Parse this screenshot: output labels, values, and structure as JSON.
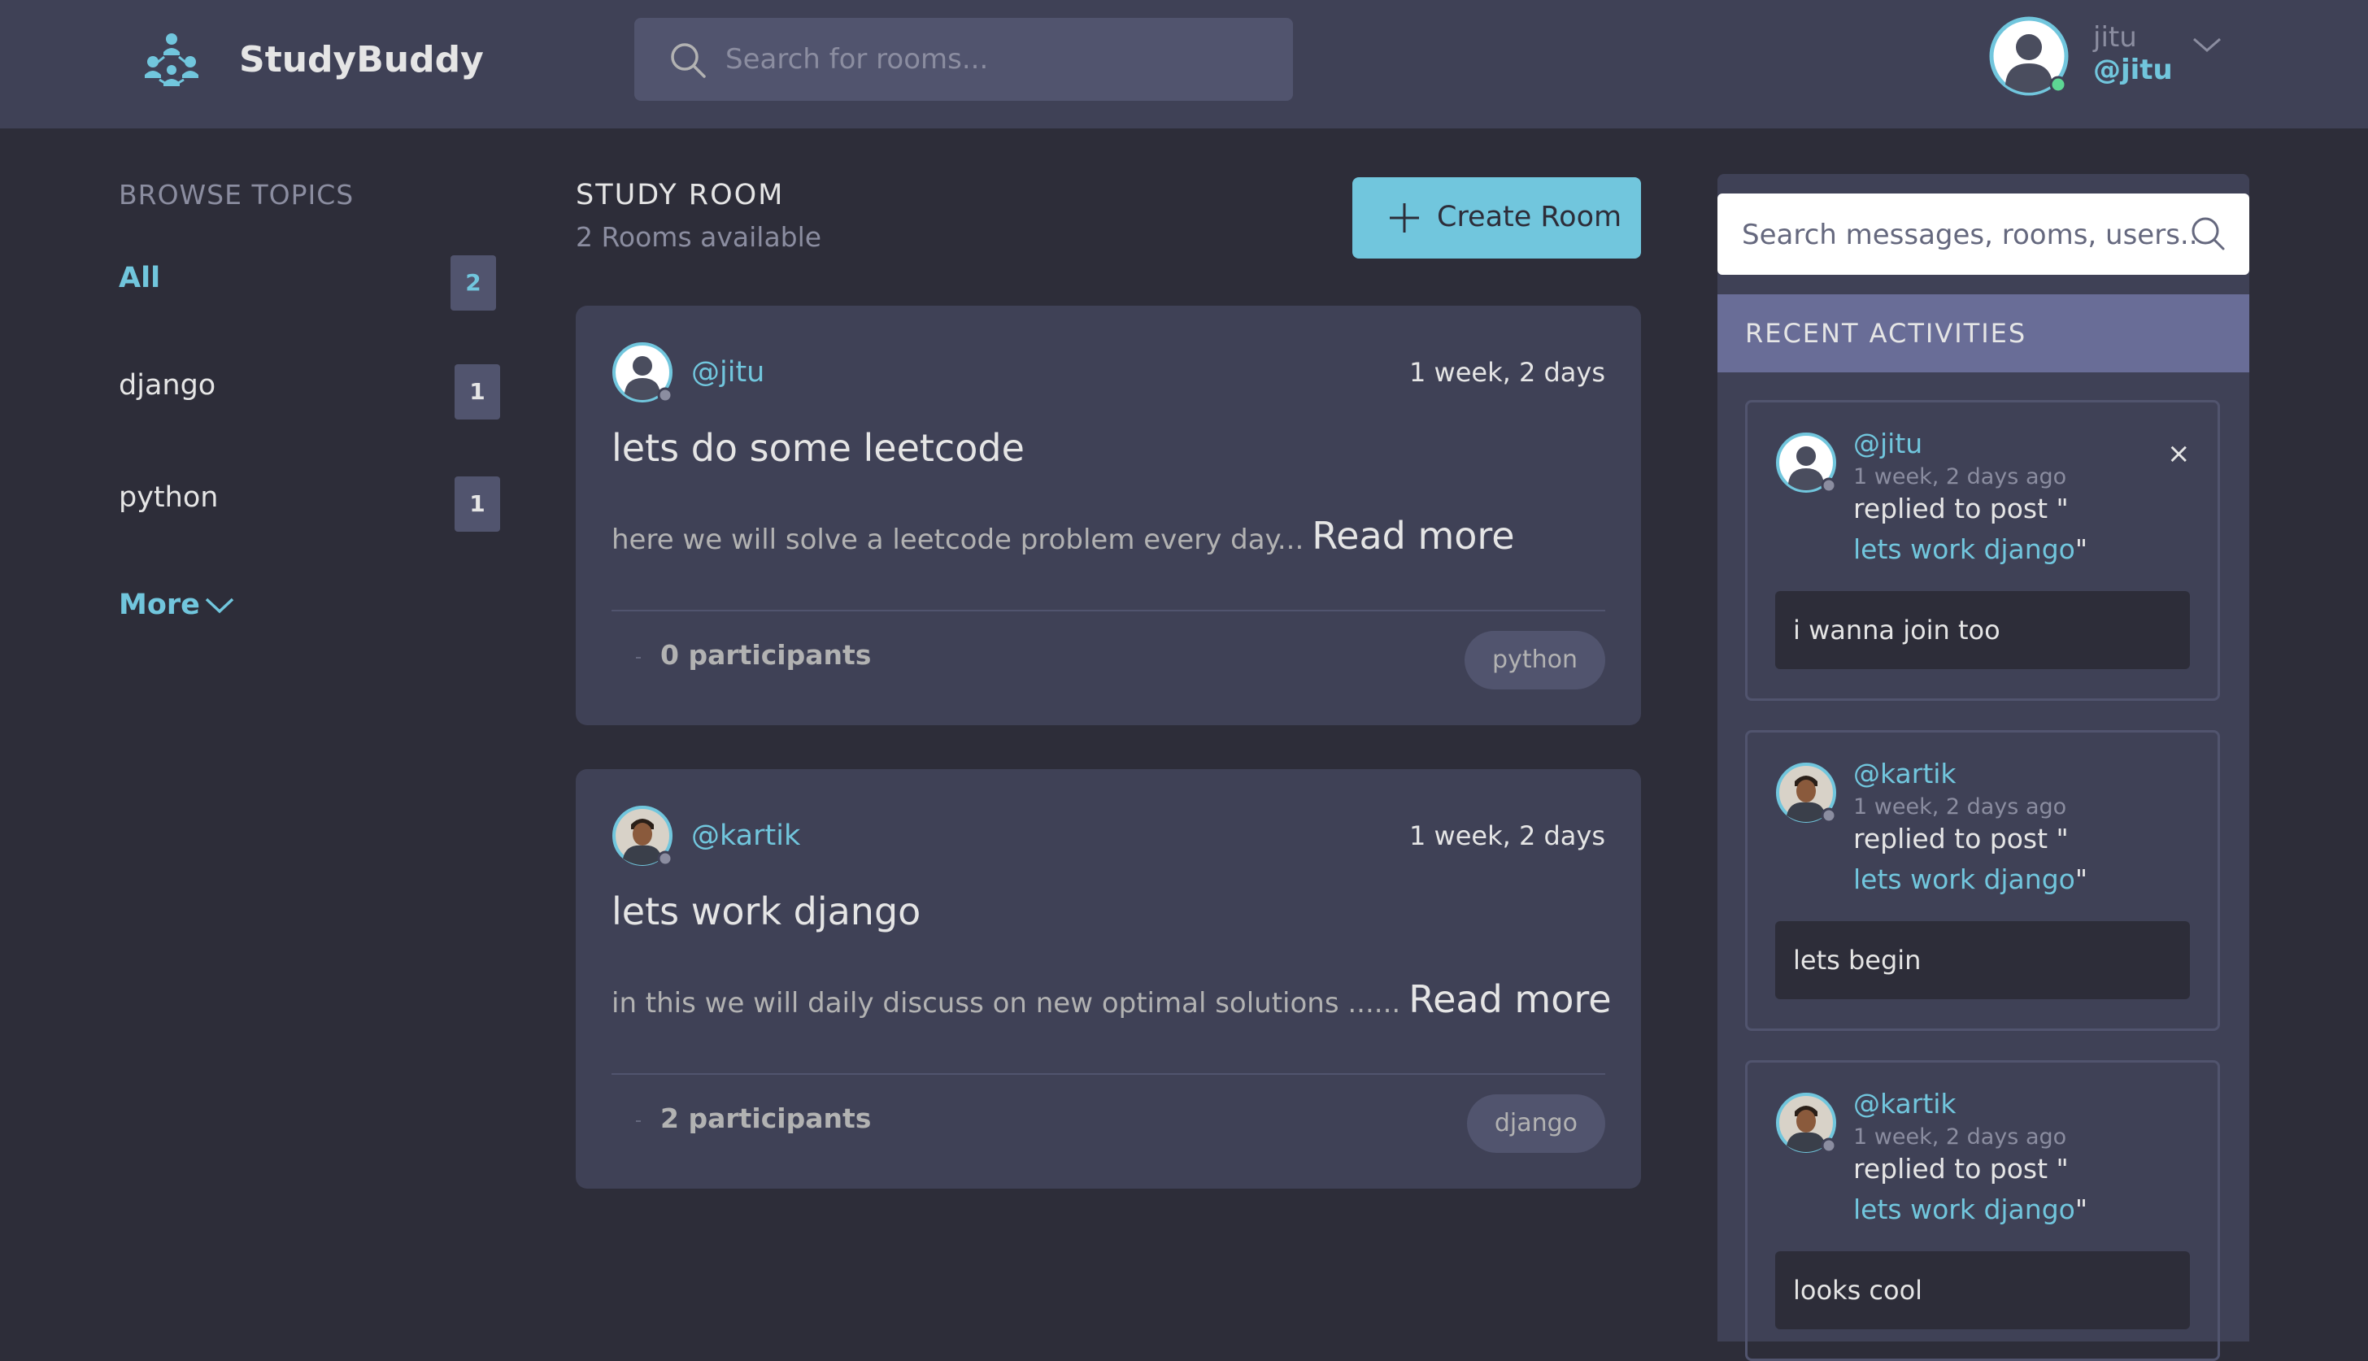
{
  "header": {
    "app_name": "StudyBuddy",
    "search_placeholder": "Search for rooms...",
    "user_name": "jitu",
    "user_handle": "@jitu"
  },
  "sidebar": {
    "title": "BROWSE TOPICS",
    "topics": [
      {
        "label": "All",
        "count": "2"
      },
      {
        "label": "django",
        "count": "1"
      },
      {
        "label": "python",
        "count": "1"
      }
    ],
    "more_label": "More"
  },
  "main": {
    "title": "STUDY ROOM",
    "subtitle": "2 Rooms available",
    "create_label": "Create Room",
    "rooms": [
      {
        "host": "@jitu",
        "time": "1 week, 2 days",
        "title": "lets do some leetcode",
        "description": "here we will solve a leetcode problem every day...",
        "read_more": "Read more",
        "participants": "0 participants",
        "topic": "python"
      },
      {
        "host": "@kartik",
        "time": "1 week, 2 days",
        "title": "lets work django",
        "description": "in this we will daily discuss on new optimal solutions ......",
        "read_more": "Read more",
        "participants": "2 participants",
        "topic": "django"
      }
    ]
  },
  "activity": {
    "search_placeholder": "Search messages, rooms, users...",
    "title": "RECENT ACTIVITIES",
    "items": [
      {
        "handle": "@jitu",
        "time": "1 week, 2 days ago",
        "replied": "replied to post \"",
        "post": "lets work django",
        "post_suffix": "\"",
        "message": "i wanna join too",
        "close": "×"
      },
      {
        "handle": "@kartik",
        "time": "1 week, 2 days ago",
        "replied": "replied to post \"",
        "post": "lets work django",
        "post_suffix": "\"",
        "message": "lets begin"
      },
      {
        "handle": "@kartik",
        "time": "1 week, 2 days ago",
        "replied": "replied to post \"",
        "post": "lets work django",
        "post_suffix": "\"",
        "message": "looks cool"
      }
    ]
  },
  "colors": {
    "background": "#2d2d39",
    "panel": "#3f4156",
    "accent": "#71c6dd",
    "activity_header": "#696d97",
    "online": "#5dd693"
  },
  "icons": [
    "studybuddy-logo-icon",
    "search-icon",
    "chevron-down-icon",
    "plus-icon",
    "close-icon",
    "avatar"
  ]
}
